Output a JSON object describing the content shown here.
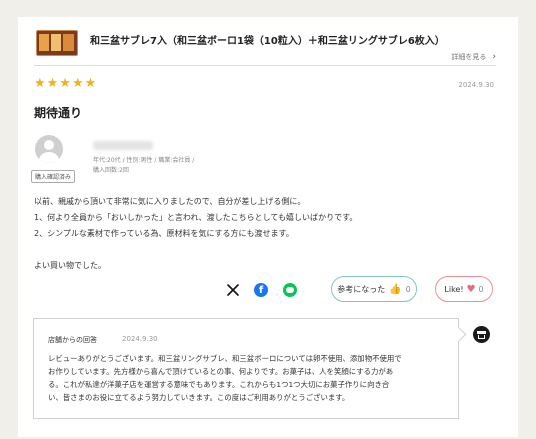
{
  "product": {
    "title": "和三盆サブレ7入（和三盆ボーロ1袋（10粒入）＋和三盆リングサブレ6枚入）",
    "detail_link": "詳細を見る",
    "detail_chevron": "›"
  },
  "review": {
    "stars": "★★★★★",
    "rating": 5,
    "date": "2024.9.30",
    "title": "期待通り",
    "user": {
      "meta_line1": "年代:20代 / 性別:男性 / 職業:会社員 /",
      "meta_line2": "購入回数:2回",
      "verified_badge": "購入確認済み"
    },
    "body": [
      "以前、親戚から頂いて非常に気に入りましたので、自分が差し上げる側に。",
      "1、何より全員から「おいしかった」と言われ、渡したこちらとしても嬉しいばかりです。",
      "2、シンプルな素材で作っている為、原材料を気にする方にも渡せます。",
      "よい買い物でした。"
    ]
  },
  "share": {
    "x_icon": "x-logo-icon",
    "facebook_icon": "facebook-icon",
    "line_icon": "line-icon"
  },
  "reactions": {
    "helpful_label": "参考になった",
    "helpful_count": "0",
    "like_label": "Like!",
    "like_count": "0"
  },
  "shop_reply": {
    "label": "店舗からの回答",
    "date": "2024.9.30",
    "body": [
      "レビューありがとうございます。和三盆リングサブレ、和三盆ボーロについては卵不使用、添加物不使用で",
      "お作りしています。先方様から喜んで頂けているとの事、何よりです。お菓子は、人を笑顔にする力があ",
      "る。これが私達が洋菓子店を運営する意味でもあります。これからも1つ1つ大切にお菓子作りに向き合",
      "い、皆さまのお役に立てるよう努力していきます。この度はご利用ありがとうございます。"
    ],
    "icon": "shop-icon"
  },
  "colors": {
    "page_bg": "#f1efe9",
    "star": "#f0b21e",
    "helpful_border": "#7fc5c5",
    "like_border": "#ef8d99",
    "heart": "#e8687e",
    "facebook": "#1877f2",
    "line": "#06c755"
  }
}
